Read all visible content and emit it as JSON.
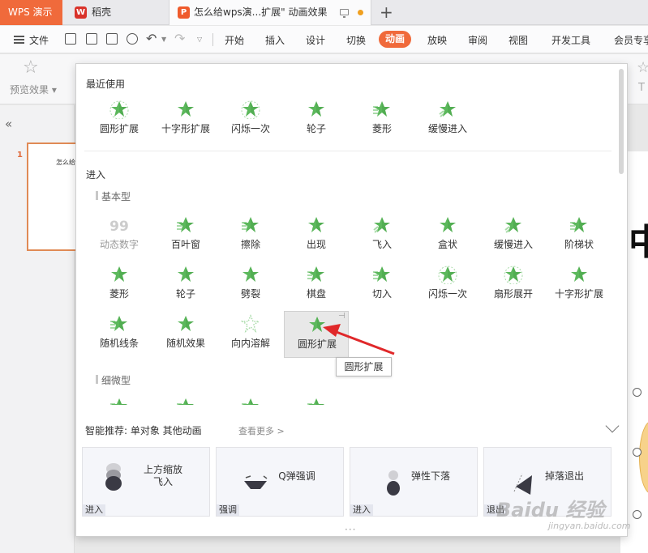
{
  "titlebar": {
    "app_tab": "WPS 演示",
    "tab1_icon": "W",
    "tab1_label": "稻壳",
    "tab2_icon": "P",
    "tab2_label": "怎么给wps演...扩展\"  动画效果"
  },
  "menubar": {
    "file": "文件",
    "items": [
      "开始",
      "插入",
      "设计",
      "切换",
      "动画",
      "放映",
      "审阅",
      "视图",
      "开发工具",
      "会员专享"
    ],
    "active_item": "动画"
  },
  "ribbon": {
    "preview_label": "预览效果"
  },
  "left_panel": {
    "slide_number": "1",
    "slide_title": "怎么给wps"
  },
  "slide": {
    "visible_char": "中"
  },
  "panel": {
    "recent_title": "最近使用",
    "recent": [
      "圆形扩展",
      "十字形扩展",
      "闪烁一次",
      "轮子",
      "菱形",
      "缓慢进入"
    ],
    "enter_title": "进入",
    "basic_title": "基本型",
    "basic_row1": [
      "动态数字",
      "百叶窗",
      "擦除",
      "出现",
      "飞入",
      "盒状",
      "缓慢进入",
      "阶梯状"
    ],
    "basic_row2": [
      "菱形",
      "轮子",
      "劈裂",
      "棋盘",
      "切入",
      "闪烁一次",
      "扇形展开",
      "十字形扩展"
    ],
    "basic_row3": [
      "随机线条",
      "随机效果",
      "向内溶解",
      "圆形扩展"
    ],
    "subtle_title": "细微型",
    "tooltip": "圆形扩展",
    "smart_label": "智能推荐:  单对象 其他动画",
    "smart_more": "查看更多 >",
    "cards": [
      {
        "label": "上方缩放\n飞入",
        "tag": "进入"
      },
      {
        "label": "Q弹强调",
        "tag": "强调"
      },
      {
        "label": "弹性下落",
        "tag": "进入"
      },
      {
        "label": "掉落退出",
        "tag": "退出"
      }
    ],
    "bottom_dots": "···"
  },
  "watermark": {
    "main": "Baidu 经验",
    "sub": "jingyan.baidu.com"
  },
  "colors": {
    "accent": "#f06a3b",
    "star_green": "#5cb85c",
    "arrow_red": "#e0282a"
  }
}
